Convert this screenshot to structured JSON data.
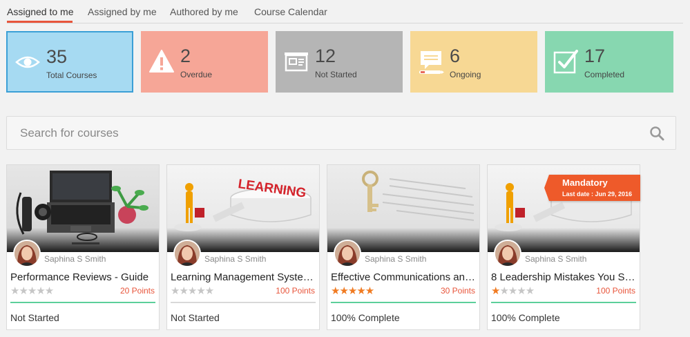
{
  "tabs": [
    {
      "label": "Assigned to me",
      "active": true
    },
    {
      "label": "Assigned by me",
      "active": false
    },
    {
      "label": "Authored by me",
      "active": false
    },
    {
      "label": "Course Calendar",
      "active": false
    }
  ],
  "stats": {
    "total": {
      "value": "35",
      "label": "Total Courses",
      "icon": "eye-icon",
      "color": "#a6daf2"
    },
    "overdue": {
      "value": "2",
      "label": "Overdue",
      "icon": "warning-icon",
      "color": "#f6a697"
    },
    "not_started": {
      "value": "12",
      "label": "Not Started",
      "icon": "projector-icon",
      "color": "#b5b5b5"
    },
    "ongoing": {
      "value": "6",
      "label": "Ongoing",
      "icon": "chat-pencil-icon",
      "color": "#f7d894"
    },
    "completed": {
      "value": "17",
      "label": "Completed",
      "icon": "checkbox-icon",
      "color": "#87d7b0"
    }
  },
  "search": {
    "placeholder": "Search for courses"
  },
  "courses": [
    {
      "title": "Performance Reviews - Guide",
      "author": "Saphina S Smith",
      "points": "20 Points",
      "rating": 0,
      "progress": 0,
      "status": "Not Started",
      "image": "laptop-desk"
    },
    {
      "title": "Learning Management Syste…",
      "author": "Saphina S Smith",
      "points": "100 Points",
      "rating": 0,
      "progress": 0,
      "status": "Not Started",
      "image": "learning-figure"
    },
    {
      "title": "Effective Communications an…",
      "author": "Saphina S Smith",
      "points": "30 Points",
      "rating": 5,
      "progress": 100,
      "status": "100% Complete",
      "image": "key-document"
    },
    {
      "title": "8 Leadership Mistakes You S…",
      "author": "Saphina S Smith",
      "points": "100 Points",
      "rating": 1,
      "progress": 100,
      "status": "100% Complete",
      "image": "learning-figure",
      "badge": "Mandatory",
      "last_date": "Last date : Jun 29, 2016"
    }
  ],
  "colors": {
    "accent": "#e8553b",
    "star": "#f07b22",
    "progress": "#5ccf9a"
  }
}
